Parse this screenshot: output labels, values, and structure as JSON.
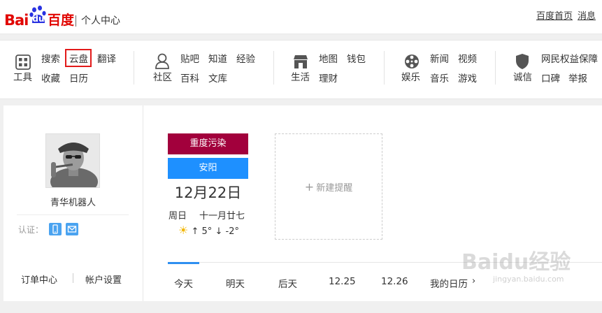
{
  "header": {
    "logo_bai": "Bai",
    "logo_du": "du",
    "logo_cn": "百度",
    "subtitle": "个人中心",
    "links": [
      "百度首页",
      "消息"
    ]
  },
  "nav": {
    "groups": [
      {
        "icon": "grid-icon",
        "icon_label": "工具",
        "items": [
          "搜索",
          "云盘",
          "翻译",
          "收藏",
          "日历"
        ]
      },
      {
        "icon": "community-icon",
        "icon_label": "社区",
        "items": [
          "贴吧",
          "知道",
          "经验",
          "百科",
          "文库"
        ]
      },
      {
        "icon": "store-icon",
        "icon_label": "生活",
        "items": [
          "地图",
          "钱包",
          "理财"
        ]
      },
      {
        "icon": "film-reel-icon",
        "icon_label": "娱乐",
        "items": [
          "新闻",
          "视频",
          "音乐",
          "游戏"
        ]
      },
      {
        "icon": "shield-icon",
        "icon_label": "诚信",
        "items": [
          "网民权益保障",
          "口碑",
          "举报"
        ]
      }
    ],
    "highlighted": "云盘"
  },
  "profile": {
    "username": "青华机器人",
    "auth_label": "认证：",
    "auth_icons": [
      "phone-icon",
      "mail-icon"
    ],
    "links": [
      "订单中心",
      "帐户设置"
    ]
  },
  "weather": {
    "air_quality": "重度污染",
    "air_quality_color": "#a2003c",
    "city": "安阳",
    "city_color": "#1e90ff",
    "date": "12月22日",
    "weekday": "周日",
    "lunar": "十一月廿七",
    "high": "5°",
    "low": "-2°"
  },
  "reminder": {
    "label": "新建提醒"
  },
  "tabs": [
    "今天",
    "明天",
    "后天",
    "12.25",
    "12.26",
    "我的日历"
  ],
  "watermark": {
    "text": "Baidu经验",
    "url": "jingyan.baidu.com"
  }
}
